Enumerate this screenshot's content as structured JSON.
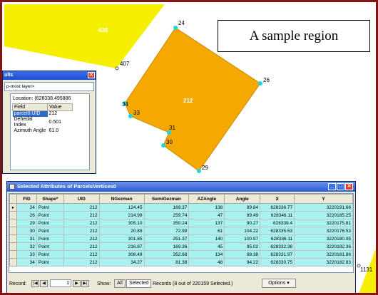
{
  "map": {
    "parcel_center_label": "212",
    "parcel_topleft_label": "438",
    "vertices": [
      {
        "label": "24"
      },
      {
        "label": "26"
      },
      {
        "label": "29"
      },
      {
        "label": "30"
      },
      {
        "label": "31"
      },
      {
        "label": "33"
      },
      {
        "label": "34"
      },
      {
        "label": "407"
      },
      {
        "label": "1131"
      }
    ],
    "colors": {
      "parcel": "#f5a800",
      "neighbor": "#f5ef00",
      "vertex": "#19d6e8",
      "frame": "#7f1414"
    }
  },
  "callout": {
    "text": "A sample region"
  },
  "identify": {
    "title": "ults",
    "layer": "p-most layer>",
    "location": "Location: (628338.495886",
    "headers": {
      "field": "Field",
      "value": "Value"
    },
    "rows": [
      {
        "field": "parcel0.UID",
        "value": "212"
      },
      {
        "field": "Dehedal Index",
        "value": "0.501"
      },
      {
        "field": "Azimuth Angle",
        "value": "61.0"
      }
    ]
  },
  "table": {
    "title": "Selected Attributes of ParcelsVertices0",
    "columns": [
      "FID",
      "Shape*",
      "UID",
      "NGezman",
      "SemiGezman",
      "AZAngle",
      "Angle",
      "X",
      "Y"
    ],
    "rows": [
      [
        "24",
        "Point",
        "212",
        "124.45",
        "169.37",
        "138",
        "89.84",
        "628336.77",
        "3220191.66"
      ],
      [
        "26",
        "Point",
        "212",
        "214.99",
        "259.74",
        "47",
        "89.49",
        "628346.11",
        "3220185.25"
      ],
      [
        "29",
        "Point",
        "212",
        "305.10",
        "350.24",
        "137",
        "90.27",
        "628339.4",
        "3220175.81"
      ],
      [
        "30",
        "Point",
        "212",
        "20.89",
        "72.99",
        "61",
        "104.22",
        "628335.53",
        "3220178.53"
      ],
      [
        "31",
        "Point",
        "212",
        "301.85",
        "251.37",
        "140",
        "100.97",
        "628336.11",
        "3220180.05"
      ],
      [
        "32",
        "Point",
        "212",
        "216.87",
        "169.36",
        "45",
        "95.02",
        "628332.36",
        "3220182.36"
      ],
      [
        "33",
        "Point",
        "212",
        "308.49",
        "352.68",
        "134",
        "88.38",
        "628331.97",
        "3220181.86"
      ],
      [
        "34",
        "Point",
        "212",
        "34.27",
        "81.38",
        "48",
        "94.22",
        "628330.75",
        "3220182.83"
      ]
    ],
    "status": {
      "record_label": "Record:",
      "record_value": "1",
      "show_label": "Show:",
      "all_label": "All",
      "selected_label": "Selected",
      "records_text": "Records (8 out of 220159 Selected.)",
      "options_label": "Options"
    }
  }
}
